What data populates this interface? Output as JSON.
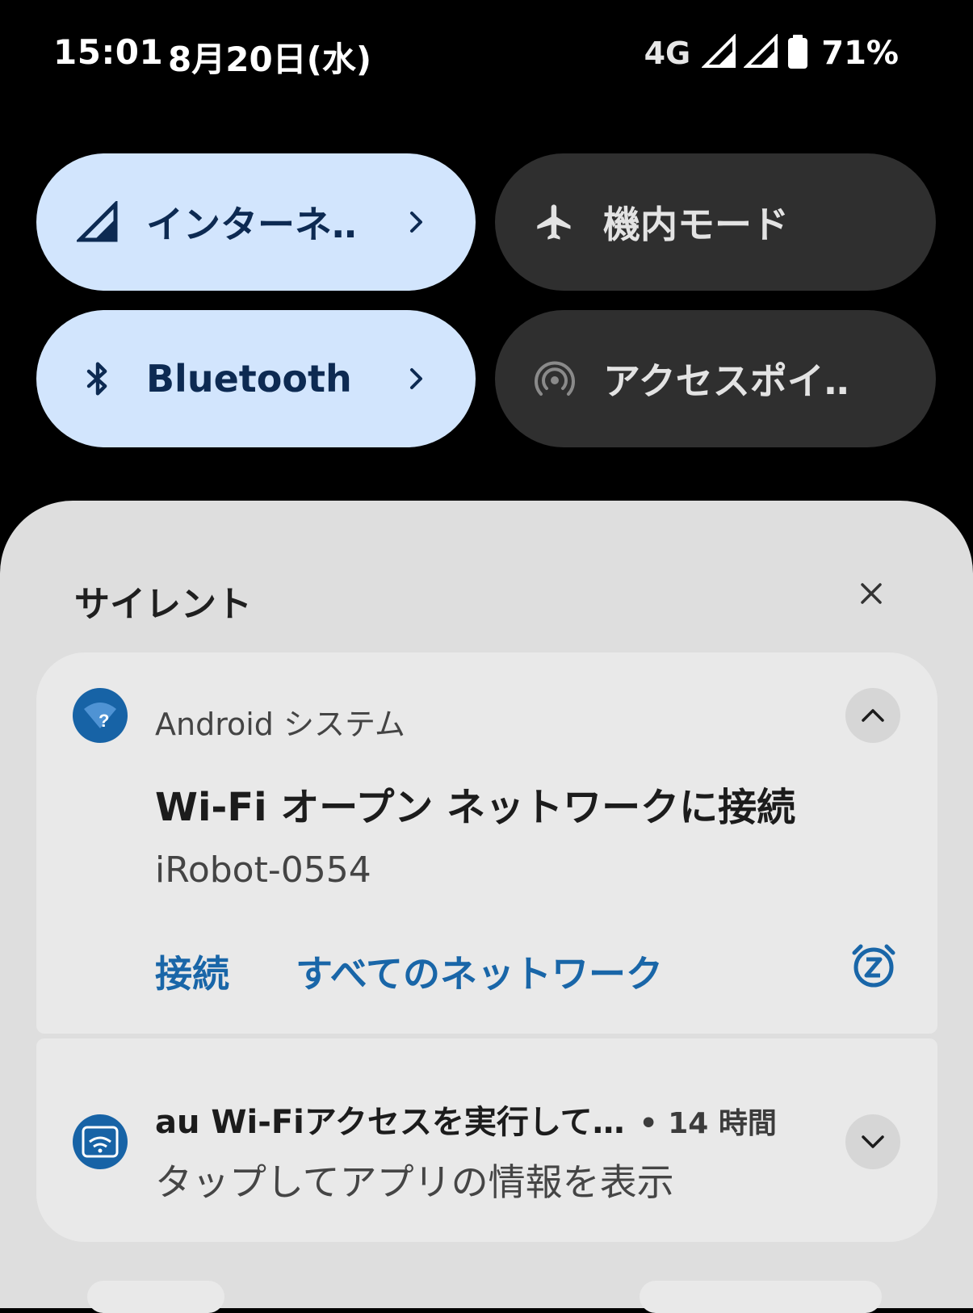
{
  "status_bar": {
    "time": "15:01",
    "date": "8月20日(水)",
    "network_type": "4G",
    "battery": "71%"
  },
  "quick_tiles": [
    {
      "label": "インターネ‥",
      "icon": "signal-icon",
      "state": "on"
    },
    {
      "label": "機内モード",
      "icon": "airplane-icon",
      "state": "off"
    },
    {
      "label": "Bluetooth",
      "icon": "bluetooth-icon",
      "state": "on"
    },
    {
      "label": "アクセスポイ‥",
      "icon": "hotspot-icon",
      "state": "off"
    }
  ],
  "notifications_section": {
    "title": "サイレント"
  },
  "notification_1": {
    "app_name": "Android システム",
    "title": "Wi-Fi オープン ネットワークに接続",
    "text": "iRobot-0554",
    "actions": [
      "接続",
      "すべてのネットワーク"
    ],
    "snooze_icon": "snooze-alarm-icon"
  },
  "notification_2": {
    "title": "au Wi-Fiアクセスを実行して…",
    "time": "• 14 時間",
    "text": "タップしてアプリの情報を表示"
  },
  "colors": {
    "tile_on": "#d2e5fd",
    "tile_off": "#2f2f2f",
    "shade": "#dedede",
    "card": "#e9e9e9",
    "accent": "#1966a8"
  }
}
